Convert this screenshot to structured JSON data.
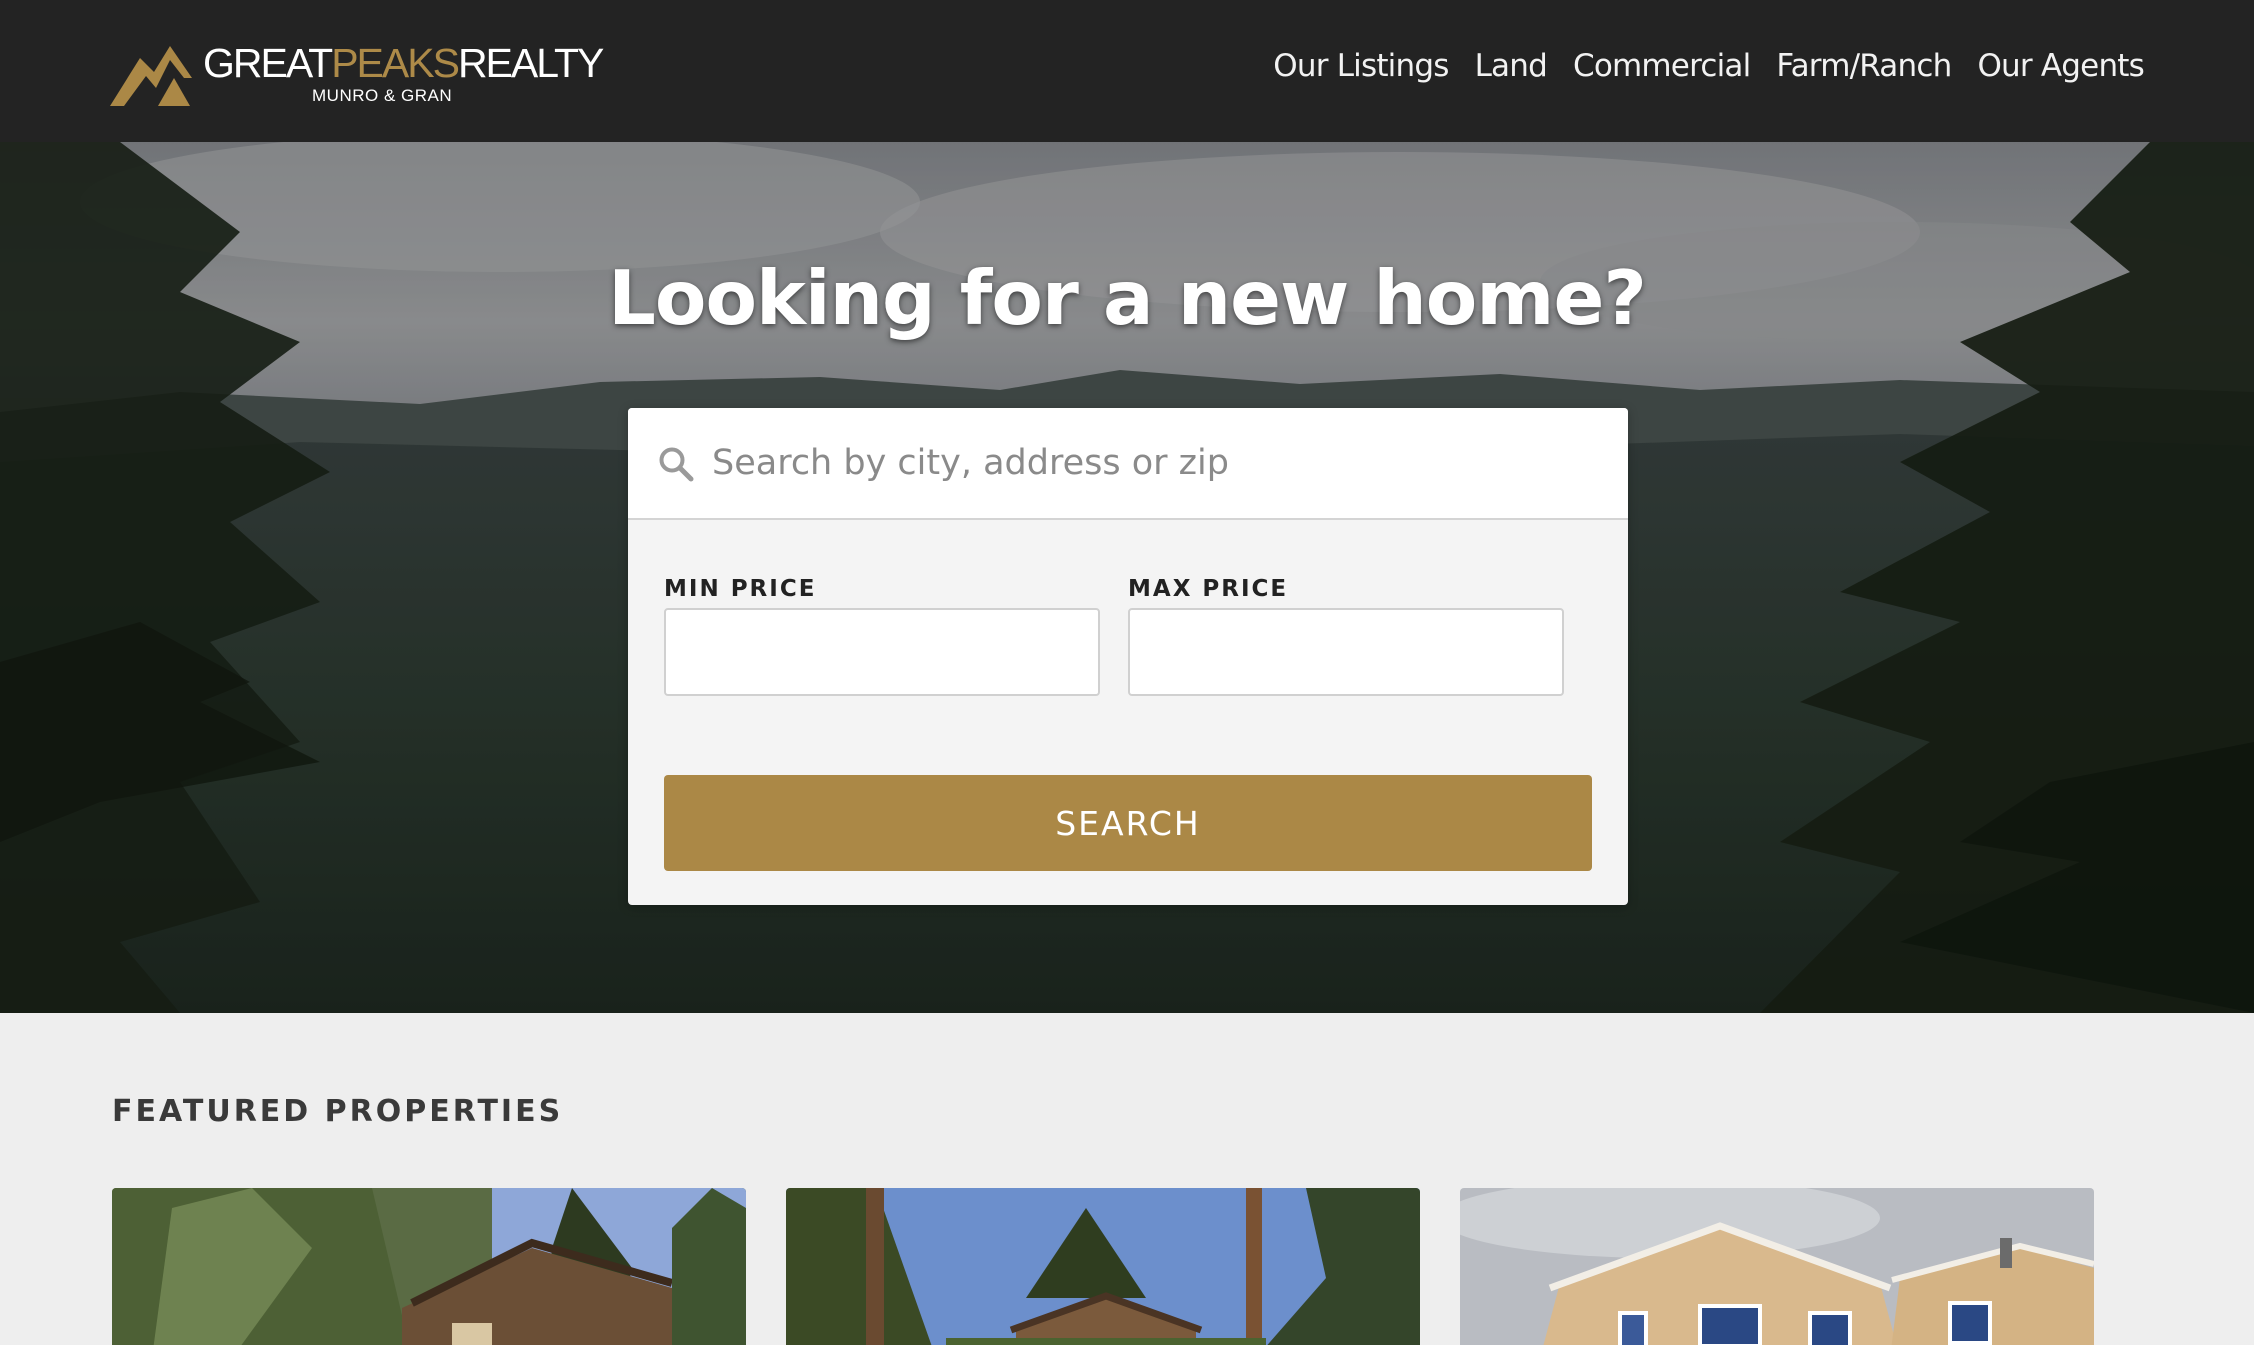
{
  "header": {
    "logo": {
      "word_white_1": "GREAT",
      "word_gold": "PEAKS",
      "word_white_2": "REALTY",
      "tagline": "MUNRO & GRAN"
    },
    "nav": [
      {
        "label": "Our Listings"
      },
      {
        "label": "Land"
      },
      {
        "label": "Commercial"
      },
      {
        "label": "Farm/Ranch"
      },
      {
        "label": "Our Agents"
      }
    ]
  },
  "hero": {
    "title": "Looking for a new home?",
    "search": {
      "placeholder": "Search by city, address or zip",
      "value": ""
    },
    "min_price": {
      "label": "MIN PRICE",
      "value": ""
    },
    "max_price": {
      "label": "MAX PRICE",
      "value": ""
    },
    "search_button": "SEARCH"
  },
  "featured": {
    "title": "FEATURED PROPERTIES",
    "properties": [
      {
        "image": "house-in-trees-photo"
      },
      {
        "image": "cabin-among-pines-photo"
      },
      {
        "image": "two-story-tan-house-photo"
      }
    ]
  },
  "colors": {
    "header_bg": "#232323",
    "accent_gold": "#ab8846",
    "page_bg": "#eeeeee",
    "card_bg": "#f4f4f4"
  }
}
